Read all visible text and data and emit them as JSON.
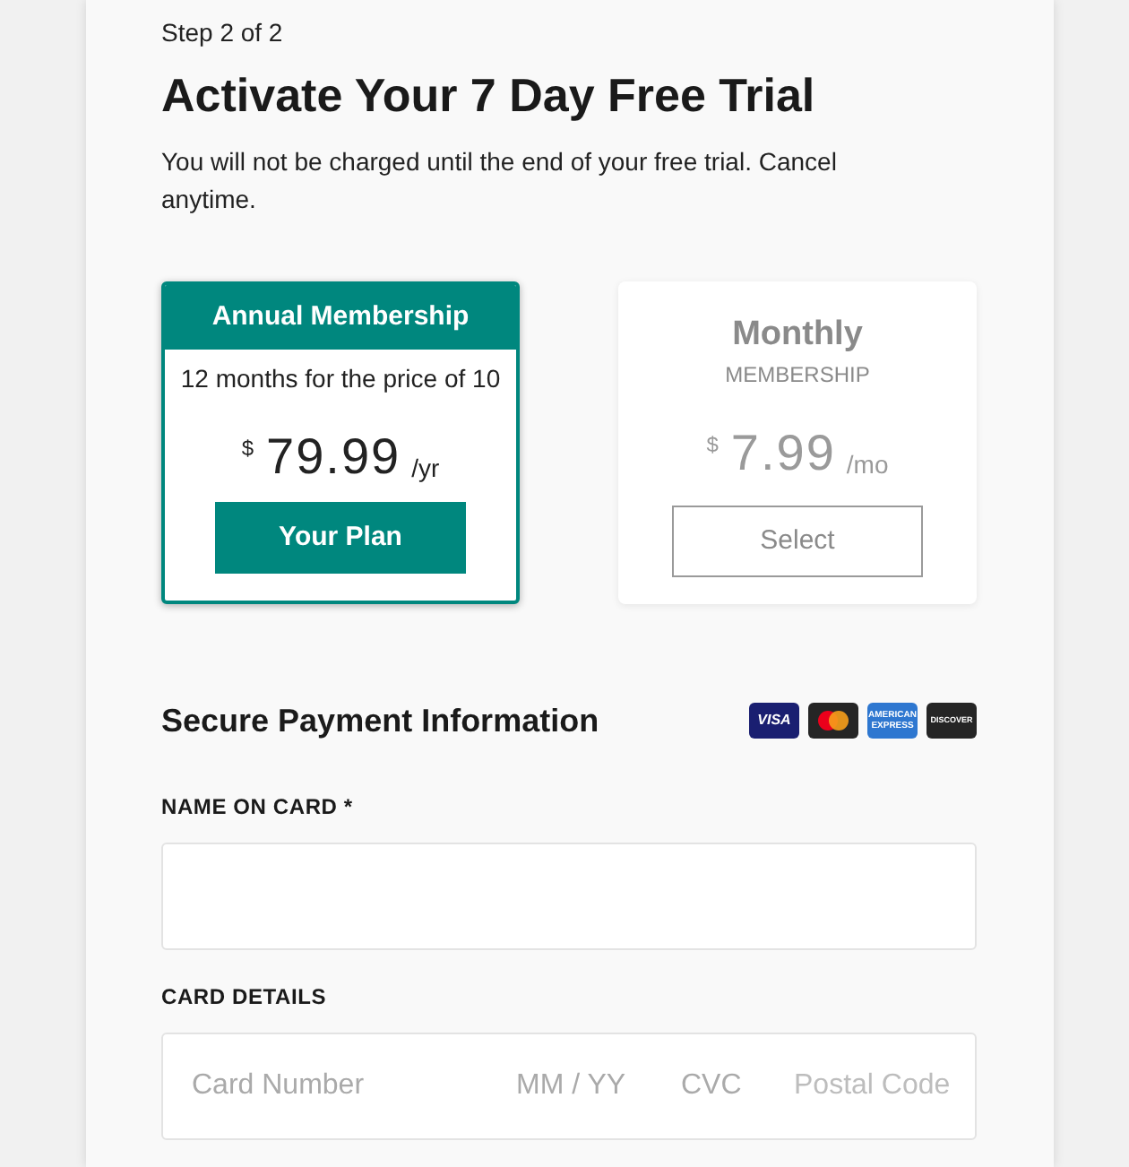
{
  "step": "Step 2 of 2",
  "title": "Activate Your 7 Day Free Trial",
  "subtitle": "You will not be charged until the end of your free trial. Cancel anytime.",
  "plans": [
    {
      "title": "Annual Membership",
      "subtitle": "12 months for the price of 10",
      "currency": "$",
      "price": "79.99",
      "period": "/yr",
      "button": "Your Plan",
      "selected": true
    },
    {
      "title": "Monthly",
      "subtitle": "MEMBERSHIP",
      "currency": "$",
      "price": "7.99",
      "period": "/mo",
      "button": "Select",
      "selected": false
    }
  ],
  "payment": {
    "title": "Secure Payment Information",
    "card_logos": [
      {
        "kind": "visa",
        "text": "VISA"
      },
      {
        "kind": "mastercard"
      },
      {
        "kind": "amex",
        "text": "AMERICAN EXPRESS"
      },
      {
        "kind": "discover",
        "text": "DISCOVER"
      }
    ],
    "fields": [
      {
        "kind": "text",
        "label": "NAME ON CARD *"
      },
      {
        "kind": "card",
        "label": "CARD DETAILS",
        "placeholders": [
          "Card Number",
          "MM / YY",
          "CVC",
          "Postal Code"
        ]
      }
    ]
  }
}
